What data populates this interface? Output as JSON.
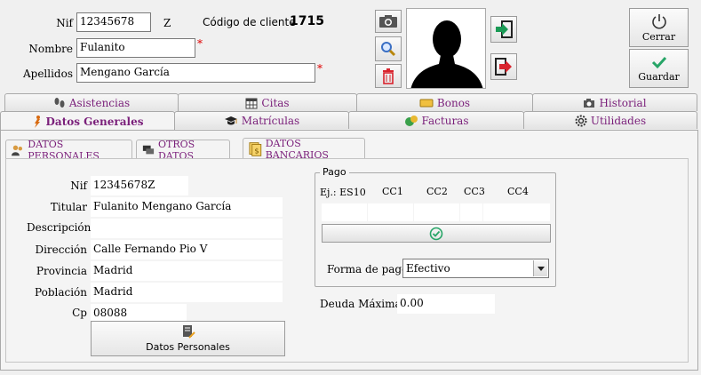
{
  "header": {
    "nif_label": "Nif",
    "nif_value": "12345678",
    "nif_letter": "Z",
    "codigo_label": "Código de cliente",
    "codigo_value": "1715",
    "nombre_label": "Nombre",
    "nombre_value": "Fulanito",
    "apellidos_label": "Apellidos",
    "apellidos_value": "Mengano García",
    "required_mark": "*"
  },
  "actions": {
    "close_label": "Cerrar",
    "save_label": "Guardar"
  },
  "tabs_row1": [
    {
      "label": "Asistencias",
      "icon": "footprints-icon"
    },
    {
      "label": "Citas",
      "icon": "calendar-icon"
    },
    {
      "label": "Bonos",
      "icon": "ticket-icon"
    },
    {
      "label": "Historial",
      "icon": "camera-icon"
    }
  ],
  "tabs_row2": [
    {
      "label": "Datos Generales",
      "icon": "figure-icon",
      "active": true
    },
    {
      "label": "Matrículas",
      "icon": "graduation-cap-icon"
    },
    {
      "label": "Facturas",
      "icon": "money-icon"
    },
    {
      "label": "Utilidades",
      "icon": "gear-icon"
    }
  ],
  "subtabs": [
    {
      "label": "DATOS PERSONALES",
      "icon": "people-icon"
    },
    {
      "label": "OTROS DATOS",
      "icon": "chat-icon"
    },
    {
      "label": "DATOS BANCARIOS",
      "icon": "document-money-icon",
      "active": true
    }
  ],
  "personal": {
    "nif_label": "Nif",
    "nif_value": "12345678Z",
    "titular_label": "Titular",
    "titular_value": "Fulanito Mengano García",
    "descripcion_label": "Descripción",
    "descripcion_value": "",
    "direccion_label": "Dirección",
    "direccion_value": "Calle Fernando Pio V",
    "provincia_label": "Provincia",
    "provincia_value": "Madrid",
    "poblacion_label": "Población",
    "poblacion_value": "Madrid",
    "cp_label": "Cp",
    "cp_value": "08088",
    "button_label": "Datos Personales"
  },
  "pago": {
    "group_label": "Pago",
    "col_example": "Ej.: ES10",
    "col_cc1": "CC1",
    "col_cc2": "CC2",
    "col_cc3": "CC3",
    "col_cc4": "CC4",
    "forma_label": "Forma de pago",
    "forma_value": "Efectivo",
    "deuda_label": "Deuda Máxima",
    "deuda_value": "0.00"
  },
  "colors": {
    "tab_text": "#7a1f7a",
    "required": "#e00000",
    "check_green": "#27a567",
    "arrow_green": "#1a9a55",
    "arrow_red": "#d9232d"
  }
}
